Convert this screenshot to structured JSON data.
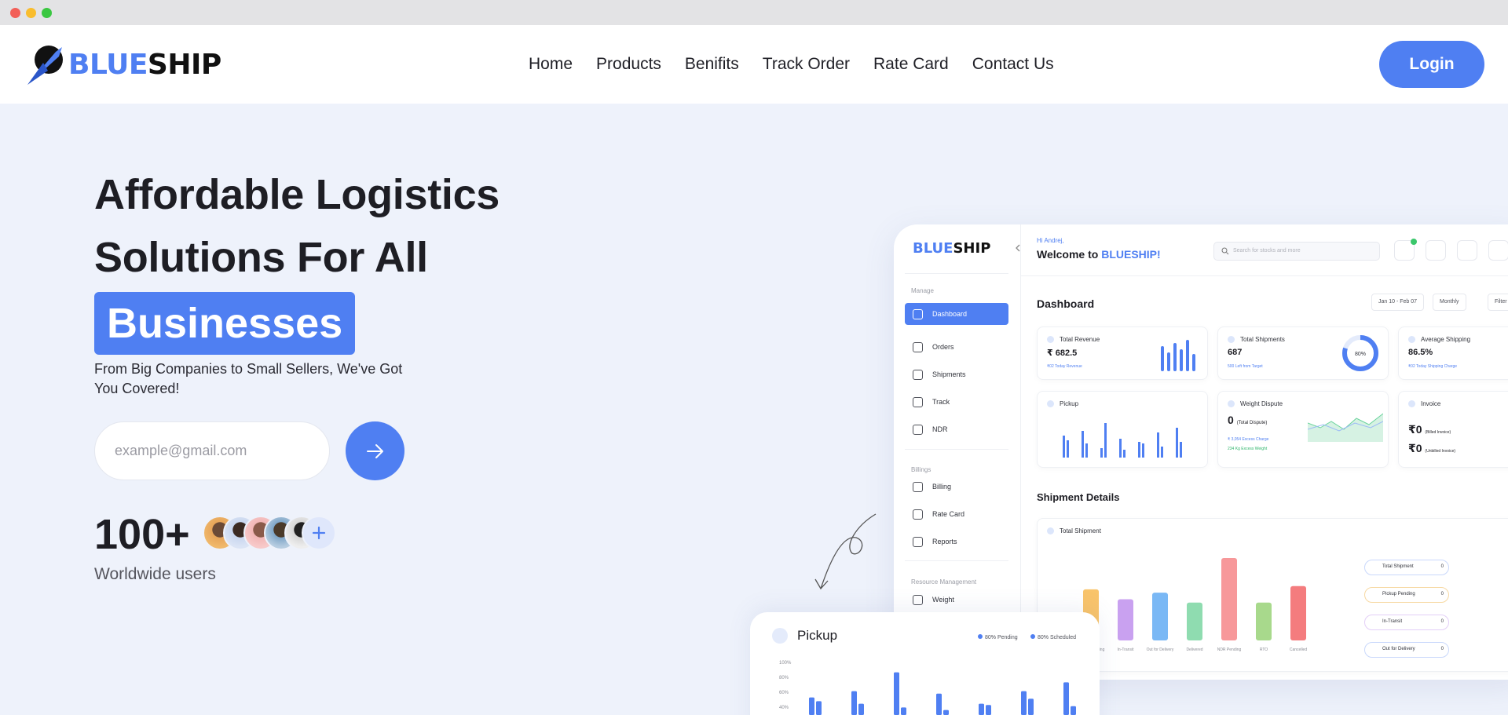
{
  "brand": {
    "prefix": "BLUE",
    "suffix": "SHIP",
    "accent": "#4f7ff2"
  },
  "nav": [
    {
      "label": "Home"
    },
    {
      "label": "Products"
    },
    {
      "label": "Benifits"
    },
    {
      "label": "Track Order"
    },
    {
      "label": "Rate Card"
    },
    {
      "label": "Contact Us"
    }
  ],
  "login_label": "Login",
  "hero": {
    "line1": "Affordable Logistics",
    "line2": "Solutions For All",
    "highlight": "Businesses",
    "subtitle": "From Big Companies to Small Sellers, We've Got You Covered!",
    "email_placeholder": "example@gmail.com",
    "submit_icon": "arrow-right-icon",
    "user_count": "100+",
    "user_label": "Worldwide users",
    "avatar_more_icon": "plus-icon"
  },
  "dashboard": {
    "logo_prefix": "BLUE",
    "logo_suffix": "SHIP",
    "sections": {
      "manage": "Manage",
      "billings": "Billings",
      "resource": "Resource Management"
    },
    "sidebar": [
      {
        "label": "Dashboard",
        "icon": "grid-icon"
      },
      {
        "label": "Orders",
        "icon": "box-icon"
      },
      {
        "label": "Shipments",
        "icon": "shipment-icon"
      },
      {
        "label": "Track",
        "icon": "track-icon"
      },
      {
        "label": "NDR",
        "icon": "ndr-icon"
      },
      {
        "label": "Billing",
        "icon": "billing-icon"
      },
      {
        "label": "Rate Card",
        "icon": "rupee-icon"
      },
      {
        "label": "Reports",
        "icon": "reports-icon"
      },
      {
        "label": "Weight",
        "icon": "weight-icon"
      }
    ],
    "greeting": "Hi Andrej,",
    "welcome_prefix": "Welcome to ",
    "welcome_brand": "BLUESHIP!",
    "search_placeholder": "Search for stocks and more",
    "title": "Dashboard",
    "date_range": "Jan 10 - Feb 07",
    "period": "Monthly",
    "filter": "Filter",
    "cards": {
      "revenue": {
        "title": "Total Revenue",
        "value": "₹ 682.5",
        "sub": "₹02 Today Revenue"
      },
      "shipments": {
        "title": "Total Shipments",
        "value": "687",
        "sub": "500 Left from Target",
        "ring": "80%",
        "ring_fraction": 0.8
      },
      "avg": {
        "title": "Average Shipping",
        "value": "86.5%",
        "sub": "₹02 Today Shipping Charge"
      },
      "pickup": {
        "title": "Pickup"
      },
      "weight": {
        "title": "Weight Dispute",
        "value": "0",
        "value_note": "(Total Dispute)",
        "line1": "₹ 3,054 Excess Charge",
        "line2": "234 Kg Excess Weight"
      },
      "invoice": {
        "title": "Invoice",
        "line1": "₹0",
        "line1_note": "(Billed Invoice)",
        "line2": "₹0",
        "line2_note": "(Unbilled Invoice)"
      }
    },
    "shipment_details_title": "Shipment Details",
    "total_shipment_title": "Total Shipment",
    "bar_colors": [
      "#f9c46b",
      "#c9a1f0",
      "#7ab8f5",
      "#8fdcb0",
      "#f7989a",
      "#a8d98c",
      "#f47c7e"
    ],
    "bar_labels": [
      "Pickup Pending",
      "In-Transit",
      "Out for Delivery",
      "Delivered",
      "NDR Pending",
      "RTO",
      "Cancelled"
    ],
    "bar_values": [
      62,
      50,
      58,
      46,
      100,
      46,
      66
    ],
    "legend": [
      {
        "label": "Total Shipment",
        "count": "0"
      },
      {
        "label": "Pickup Pending",
        "count": "0"
      },
      {
        "label": "In-Transit",
        "count": "0"
      },
      {
        "label": "Out for Delivery",
        "count": "0"
      }
    ]
  },
  "pickup_card": {
    "title": "Pickup",
    "legend_pending": "80% Pending",
    "legend_scheduled": "80% Scheduled",
    "ticks": [
      "100%",
      "80%",
      "60%",
      "40%"
    ],
    "pending_values": [
      0.28,
      0.38,
      0.68,
      0.34,
      0.18,
      0.38,
      0.52
    ],
    "scheduled_values": [
      0.22,
      0.18,
      0.12,
      0.08,
      0.16,
      0.26,
      0.14
    ]
  },
  "colors": {
    "accent": "#4f7ff2",
    "background": "#eef2fb"
  }
}
